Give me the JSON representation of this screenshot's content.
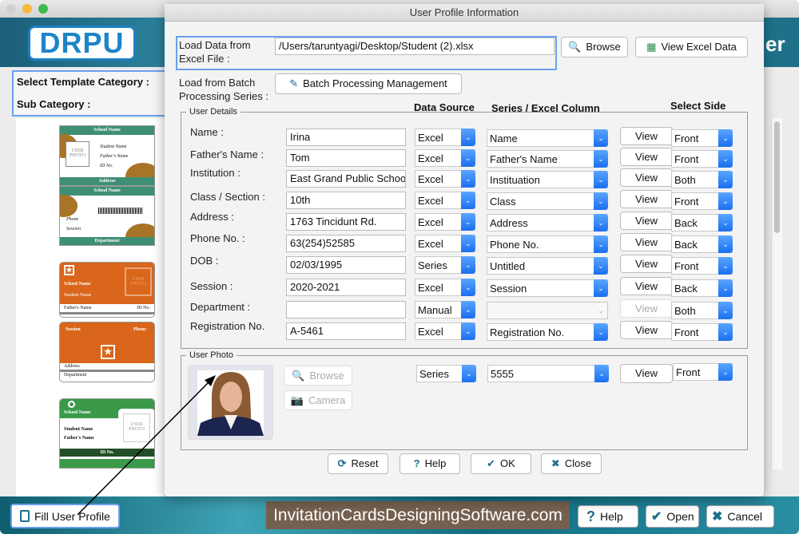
{
  "app": {
    "logo": "DRPU",
    "banner_partial": "er",
    "template_category_label": "Select Template Category :",
    "sub_category_label": "Sub Category :",
    "templates": [
      {
        "front": {
          "header": "School Name",
          "photo": "USER PHOTO",
          "lines": [
            "Student Name",
            "Father's Name",
            "ID No."
          ],
          "footer": "Address"
        },
        "back": {
          "header": "School Name",
          "lines": [
            "Phone",
            "Session"
          ],
          "footer": "Department"
        },
        "color": "#3f8f75"
      },
      {
        "front": {
          "header": "School Name",
          "photo": "USER PHOTO",
          "lines": [
            "Student Name"
          ],
          "row": [
            "Father's Name",
            "ID No."
          ]
        },
        "back": {
          "lines": [
            "Session",
            "Phone"
          ],
          "rows": [
            "Address",
            "Department"
          ]
        },
        "color": "#d9661a"
      },
      {
        "front": {
          "header": "School Name",
          "photo": "USER PHOTO",
          "lines": [
            "Student Name",
            "Father's Name"
          ],
          "footer": "ID No."
        },
        "color": "#3a9a4a"
      }
    ],
    "footer": {
      "fill_profile": "Fill User Profile",
      "website": "InvitationCardsDesigningSoftware.com",
      "help": "Help",
      "open": "Open",
      "cancel": "Cancel"
    }
  },
  "dialog": {
    "title": "User Profile Information",
    "excel_label": "Load Data from Excel File :",
    "excel_path": "/Users/taruntyagi/Desktop/Student (2).xlsx",
    "browse": "Browse",
    "view_excel": "View Excel Data",
    "batch_label": "Load from Batch Processing Series :",
    "batch_button": "Batch Processing Management",
    "user_details_legend": "User Details",
    "headers": {
      "data_source": "Data Source",
      "series_column": "Series / Excel Column",
      "select_side": "Select Side"
    },
    "view_label": "View",
    "rows": [
      {
        "label": "Name :",
        "value": "Irina",
        "source": "Excel",
        "column": "Name",
        "side": "Front"
      },
      {
        "label": "Father's Name :",
        "value": "Tom",
        "source": "Excel",
        "column": "Father's Name",
        "side": "Front"
      },
      {
        "label": "Institution :",
        "value": "East Grand Public School",
        "source": "Excel",
        "column": "Instituation",
        "side": "Both"
      },
      {
        "label": "Class / Section :",
        "value": "10th",
        "source": "Excel",
        "column": "Class",
        "side": "Front"
      },
      {
        "label": "Address :",
        "value": "1763 Tincidunt Rd.",
        "source": "Excel",
        "column": "Address",
        "side": "Back"
      },
      {
        "label": "Phone No. :",
        "value": "63(254)52585",
        "source": "Excel",
        "column": "Phone No.",
        "side": "Back"
      },
      {
        "label": "DOB :",
        "value": "02/03/1995",
        "source": "Series",
        "column": "Untitled",
        "side": "Front"
      },
      {
        "label": "Session :",
        "value": "2020-2021",
        "source": "Excel",
        "column": "Session",
        "side": "Back"
      },
      {
        "label": "Department :",
        "value": "",
        "source": "Manual",
        "column": "",
        "side": "Both",
        "disabled": true
      },
      {
        "label": "Registration No.",
        "value": "A-5461",
        "source": "Excel",
        "column": "Registration No.",
        "side": "Front"
      }
    ],
    "photo": {
      "legend": "User Photo",
      "browse": "Browse",
      "camera": "Camera",
      "source": "Series",
      "column": "5555",
      "view": "View",
      "side": "Front"
    },
    "buttons": {
      "reset": "Reset",
      "help": "Help",
      "ok": "OK",
      "close": "Close"
    }
  }
}
